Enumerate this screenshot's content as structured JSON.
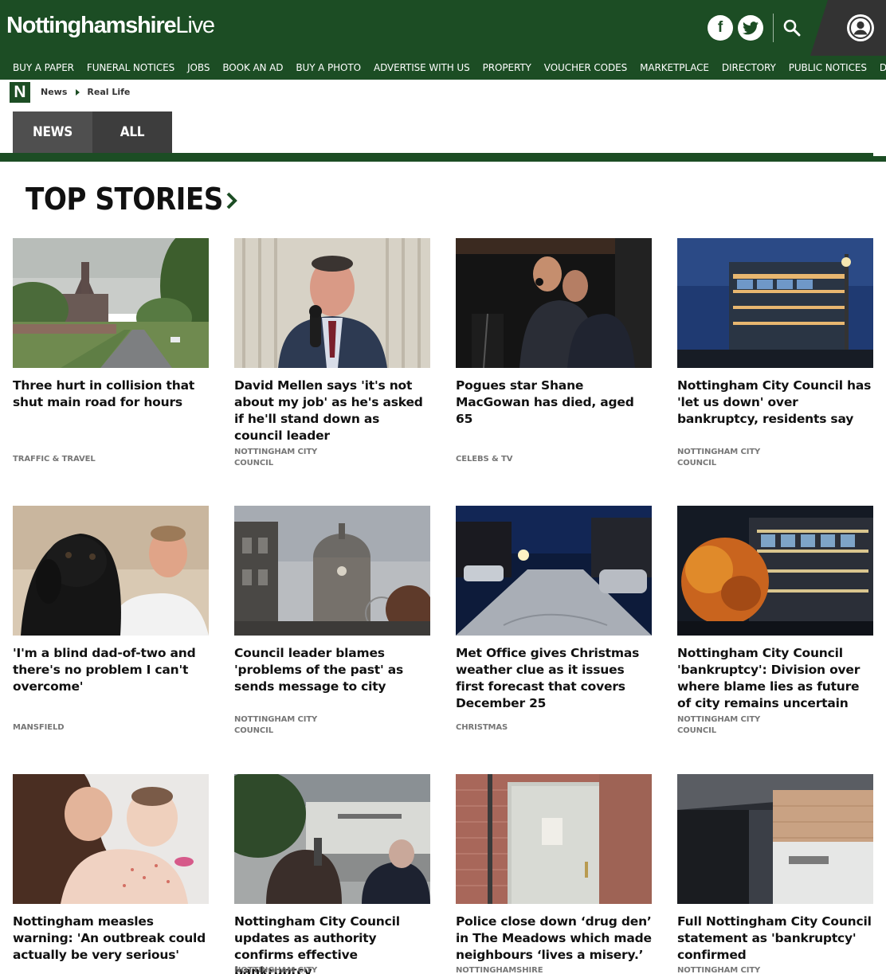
{
  "header": {
    "logo_bold": "Nottinghamshire",
    "logo_regular": "Live",
    "brand_color": "#1c4d24",
    "icons": [
      "facebook-icon",
      "twitter-icon",
      "search-icon",
      "account-icon"
    ]
  },
  "nav": {
    "items": [
      "BUY A PAPER",
      "FUNERAL NOTICES",
      "JOBS",
      "BOOK AN AD",
      "BUY A PHOTO",
      "ADVERTISE WITH US",
      "PROPERTY",
      "VOUCHER CODES",
      "MARKETPLACE",
      "DIRECTORY",
      "PUBLIC NOTICES",
      "DATING"
    ]
  },
  "breadcrumb": {
    "badge": "N",
    "items": [
      "News",
      "Real Life"
    ]
  },
  "tabs": [
    "NEWS",
    "ALL"
  ],
  "section": {
    "title": "TOP STORIES"
  },
  "stories": [
    {
      "title": "Three hurt in collision that shut main road for hours",
      "tag": "TRAFFIC & TRAVEL",
      "image": "road-with-church-photo"
    },
    {
      "title": "David Mellen says 'it's not about my job' as he's asked if he'll stand down as council leader",
      "tag": "NOTTINGHAM CITY COUNCIL",
      "image": "man-speaking-at-microphone-photo"
    },
    {
      "title": "Pogues star Shane MacGowan has died, aged 65",
      "tag": "CELEBS & TV",
      "image": "singers-on-stage-photo"
    },
    {
      "title": "Nottingham City Council has 'let us down' over bankruptcy, residents say",
      "tag": "NOTTINGHAM CITY COUNCIL",
      "image": "council-building-at-dusk-photo"
    },
    {
      "title": "'I'm a blind dad-of-two and there's no problem I can't overcome'",
      "tag": "MANSFIELD",
      "image": "man-with-black-labrador-photo"
    },
    {
      "title": "Council leader blames 'problems of the past' as sends message to city",
      "tag": "NOTTINGHAM CITY COUNCIL",
      "image": "council-house-dome-photo"
    },
    {
      "title": "Met Office gives Christmas weather clue as it issues first forecast that covers December 25",
      "tag": "CHRISTMAS",
      "image": "frosty-street-at-night-photo"
    },
    {
      "title": "Nottingham City Council 'bankruptcy': Division over where blame lies as future of city remains uncertain",
      "tag": "NOTTINGHAM CITY COUNCIL",
      "image": "loxley-house-autumn-night-photo"
    },
    {
      "title": "Nottingham measles warning: 'An outbreak could actually be very serious'",
      "tag": "",
      "image": "mother-and-baby-photo"
    },
    {
      "title": "Nottingham City Council updates as authority confirms effective bankruptcy",
      "tag": "NOTTINGHAM CITY",
      "image": "people-outside-loxley-house-photo"
    },
    {
      "title": "Police close down ‘drug den’ in The Meadows which made neighbours ‘lives a misery.’",
      "tag": "NOTTINGHAMSHIRE",
      "image": "sealed-door-photo"
    },
    {
      "title": "Full Nottingham City Council statement as 'bankruptcy' confirmed",
      "tag": "NOTTINGHAM CITY",
      "image": "loxley-house-entrance-photo"
    }
  ]
}
